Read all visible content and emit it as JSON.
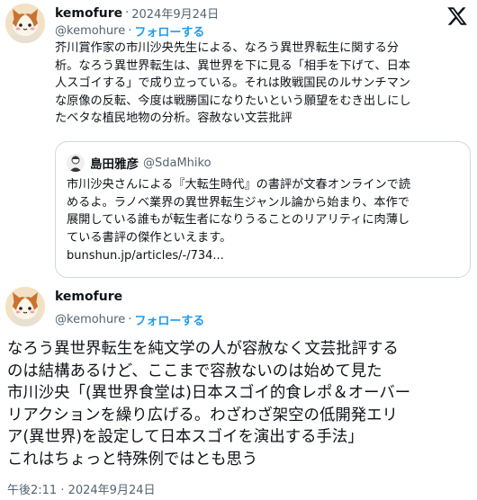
{
  "post1": {
    "name": "kemofure",
    "date": "2024年9月24日",
    "handle": "@kemohure",
    "separator": "·",
    "follow_label": "フォローする",
    "lines": [
      "芥川賞作家の市川沙央先生による、なろう異世界転生に関する分",
      "析。なろう異世界転生は、異世界を下に見る「相手を下げて、日本",
      "人スゴイする」で成り立っている。それは敗戦国民のルサンチマン",
      "な原像の反転、今度は戦勝国になりたいという願望をむき出しにし",
      "たベタな植民地物の分析。容赦ない文芸批評"
    ]
  },
  "quote": {
    "name": "島田雅彦",
    "handle": "@SdaMhiko",
    "lines": [
      "市川沙央さんによる『大転生時代』の書評が文春オンラインで読",
      "めるよ。ラノベ業界の異世界転生ジャンル論から始まり、本作で",
      "展開している誰もが転生者になりうることのリアリティに肉薄し",
      "ている書評の傑作といえます。"
    ],
    "link": "bunshun.jp/articles/-/734..."
  },
  "post2": {
    "name": "kemofure",
    "handle": "@kemohure",
    "separator": "·",
    "follow_label": "フォローする",
    "lines": [
      "なろう異世界転生を純文学の人が容赦なく文芸批評する",
      "のは結構あるけど、ここまで容赦ないのは始めて見た",
      "市川沙央「(異世界食堂は)日本スゴイ的食レポ＆オーバー",
      "リアクションを繰り広げる。わざわざ架空の低開発エリ",
      "ア(異世界)を設定して日本スゴイを演出する手法」",
      "これはちょっと特殊例ではとも思う"
    ],
    "timestamp": "午後2:11 · 2024年9月24日"
  },
  "icons": {
    "x_logo": "x-logo-icon",
    "avatar": "cat-avatar"
  },
  "colors": {
    "link_blue": "#1d9bf0",
    "muted": "#536471",
    "border": "#cfd9de"
  }
}
